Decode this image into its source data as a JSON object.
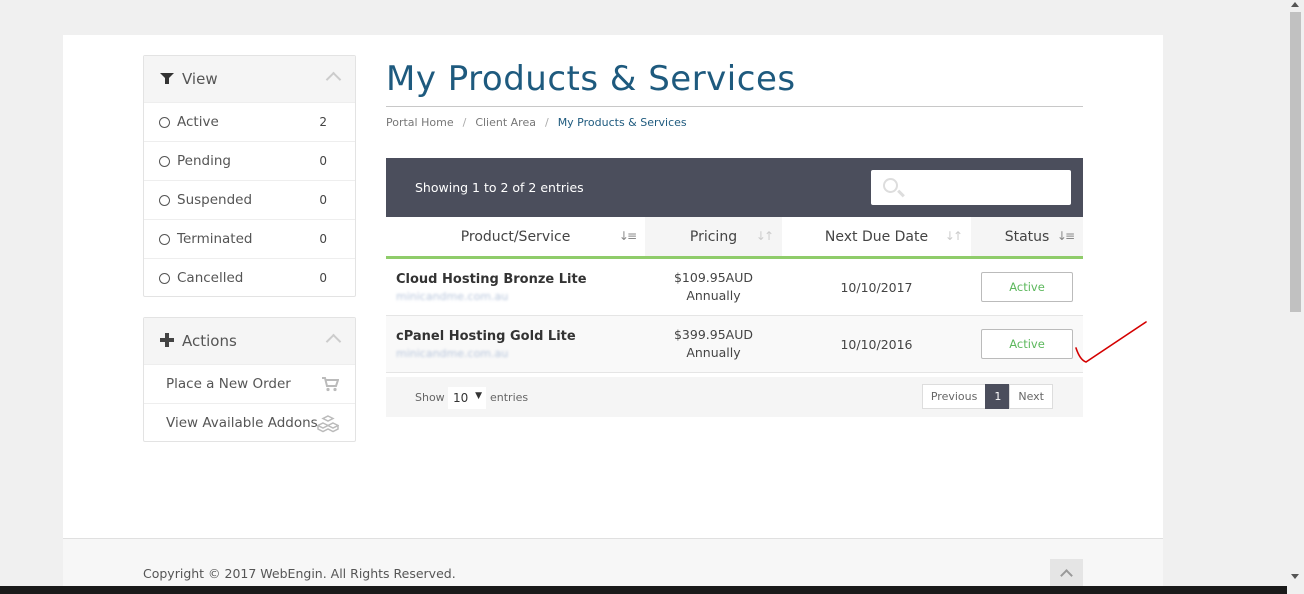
{
  "view_panel": {
    "title": "View",
    "filters": [
      {
        "label": "Active",
        "count": "2"
      },
      {
        "label": "Pending",
        "count": "0"
      },
      {
        "label": "Suspended",
        "count": "0"
      },
      {
        "label": "Terminated",
        "count": "0"
      },
      {
        "label": "Cancelled",
        "count": "0"
      }
    ]
  },
  "actions_panel": {
    "title": "Actions",
    "items": [
      {
        "label": "Place a New Order",
        "icon": "cart-icon"
      },
      {
        "label": "View Available Addons",
        "icon": "cubes-icon"
      }
    ]
  },
  "page": {
    "title": "My Products & Services",
    "breadcrumb": [
      "Portal Home",
      "Client Area",
      "My Products & Services"
    ]
  },
  "table": {
    "showing": "Showing 1 to 2 of 2 entries",
    "search_placeholder": "",
    "columns": [
      "Product/Service",
      "Pricing",
      "Next Due Date",
      "Status"
    ],
    "rows": [
      {
        "product": "Cloud Hosting Bronze Lite",
        "domain": "minicandme.com.au",
        "price": "$109.95AUD",
        "cycle": "Annually",
        "due": "10/10/2017",
        "status": "Active"
      },
      {
        "product": "cPanel Hosting Gold Lite",
        "domain": "minicandme.com.au",
        "price": "$399.95AUD",
        "cycle": "Annually",
        "due": "10/10/2016",
        "status": "Active"
      }
    ],
    "show_label": "Show",
    "page_length": "10",
    "entries_label": "entries",
    "pager": {
      "previous": "Previous",
      "current": "1",
      "next": "Next"
    }
  },
  "footer": {
    "copyright": "Copyright © 2017 WebEngin. All Rights Reserved."
  },
  "colors": {
    "title": "#1e5a7e",
    "table_header": "#4b4e5c",
    "accent_green": "#8fcc6a",
    "status_text": "#5cb85c",
    "annotation": "#d40000"
  }
}
